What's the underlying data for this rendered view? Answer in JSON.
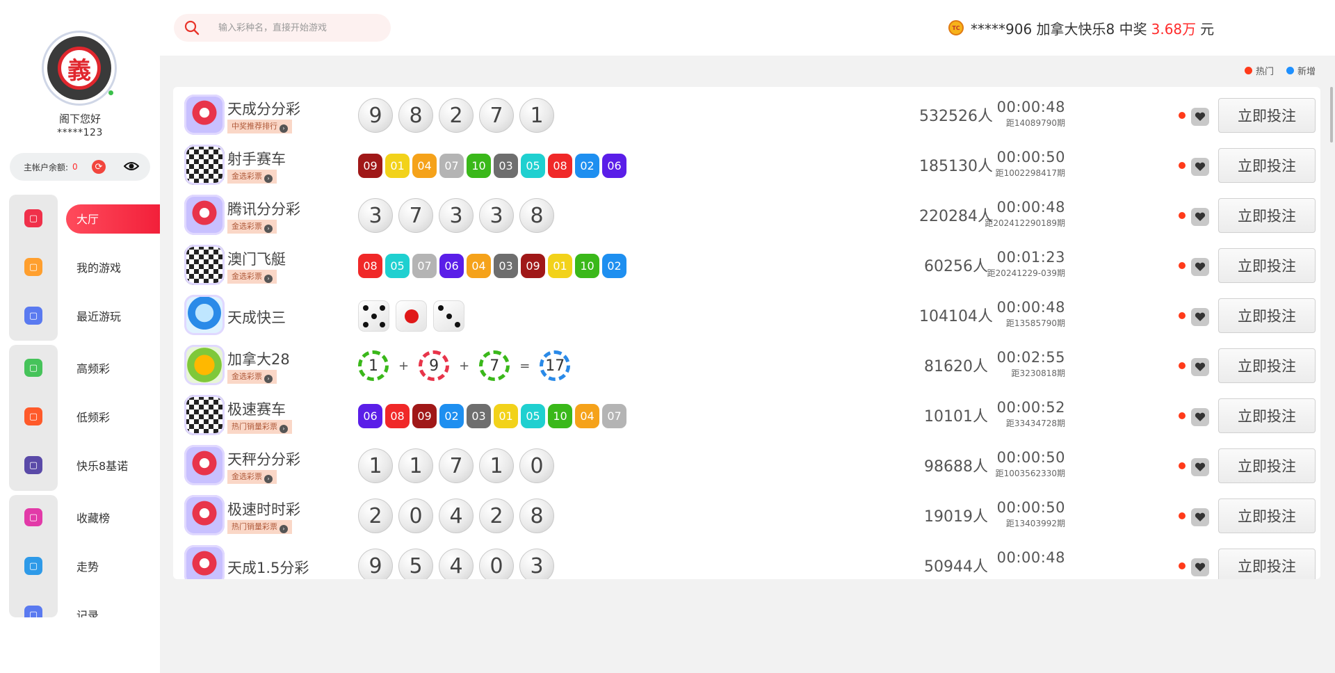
{
  "user": {
    "greeting": "阁下您好",
    "name": "*****123",
    "balance_label": "主帐户余额:",
    "balance_value": "0"
  },
  "nav": [
    {
      "label": "大厅",
      "icon": "home-icon",
      "color": "#f0304a",
      "active": true
    },
    {
      "label": "我的游戏",
      "icon": "grid-icon",
      "color": "#ff9f2e"
    },
    {
      "label": "最近游玩",
      "icon": "recent-icon",
      "color": "#5a7af0"
    },
    {
      "label": "高频彩",
      "icon": "high-freq-icon",
      "color": "#46c35a"
    },
    {
      "label": "低频彩",
      "icon": "low-freq-icon",
      "color": "#ff5a2a"
    },
    {
      "label": "快乐8基诺",
      "icon": "keno-icon",
      "color": "#5a4aa8"
    },
    {
      "label": "收藏榜",
      "icon": "favorites-icon",
      "color": "#e23aa8"
    },
    {
      "label": "走势",
      "icon": "trend-icon",
      "color": "#2e9ae8"
    },
    {
      "label": "记录",
      "icon": "record-icon",
      "color": "#5a7af0"
    }
  ],
  "search": {
    "placeholder": "输入彩种名，直接开始游戏"
  },
  "ticker": {
    "text": "*****906 加拿大快乐8 中奖",
    "amount": "3.68万",
    "unit": "元",
    "badge": "TC"
  },
  "legend": {
    "hot": "热门",
    "new": "新增",
    "hot_color": "#ff3a1a",
    "new_color": "#1e90ff"
  },
  "bet_label": "立即投注",
  "games": [
    {
      "name": "天成分分彩",
      "tag": "中奖推荐排行",
      "type": "big",
      "balls": [
        "9",
        "8",
        "2",
        "7",
        "1"
      ],
      "timer": "00:00:48",
      "period": "距14089790期",
      "people": "532526人",
      "icon": "ssc-icon"
    },
    {
      "name": "射手赛车",
      "tag": "金选彩票",
      "type": "square",
      "balls": [
        "09",
        "01",
        "04",
        "07",
        "10",
        "03",
        "05",
        "08",
        "02",
        "06"
      ],
      "timer": "00:00:50",
      "period": "距1002298417期",
      "people": "185130人",
      "icon": "racing-icon"
    },
    {
      "name": "腾讯分分彩",
      "tag": "金选彩票",
      "type": "big",
      "balls": [
        "3",
        "7",
        "3",
        "3",
        "8"
      ],
      "timer": "00:00:48",
      "period": "距202412290189期",
      "people": "220284人",
      "icon": "ssc-icon"
    },
    {
      "name": "澳门飞艇",
      "tag": "金选彩票",
      "type": "square",
      "balls": [
        "08",
        "05",
        "07",
        "06",
        "04",
        "03",
        "09",
        "01",
        "10",
        "02"
      ],
      "timer": "00:01:23",
      "period": "距20241229-039期",
      "people": "60256人",
      "icon": "racing-icon"
    },
    {
      "name": "天成快三",
      "tag": "",
      "type": "dice",
      "balls": [
        "5",
        "1",
        "3"
      ],
      "timer": "00:00:48",
      "period": "距13585790期",
      "people": "104104人",
      "icon": "k3-icon"
    },
    {
      "name": "加拿大28",
      "tag": "金选彩票",
      "type": "pc28",
      "balls": [
        "1",
        "9",
        "7",
        "17"
      ],
      "ops": [
        "+",
        "+",
        "="
      ],
      "timer": "00:02:55",
      "period": "距3230818期",
      "people": "81620人",
      "icon": "pc28-icon"
    },
    {
      "name": "极速赛车",
      "tag": "热门销量彩票",
      "type": "square",
      "balls": [
        "06",
        "08",
        "09",
        "02",
        "03",
        "01",
        "05",
        "10",
        "04",
        "07"
      ],
      "timer": "00:00:52",
      "period": "距33434728期",
      "people": "10101人",
      "icon": "racing-icon"
    },
    {
      "name": "天秤分分彩",
      "tag": "金选彩票",
      "type": "big",
      "balls": [
        "1",
        "1",
        "7",
        "1",
        "0"
      ],
      "timer": "00:00:50",
      "period": "距1003562330期",
      "people": "98688人",
      "icon": "ssc-icon"
    },
    {
      "name": "极速时时彩",
      "tag": "热门销量彩票",
      "type": "big",
      "balls": [
        "2",
        "0",
        "4",
        "2",
        "8"
      ],
      "timer": "00:00:50",
      "period": "距13403992期",
      "people": "19019人",
      "icon": "ssc-icon"
    },
    {
      "name": "天成1.5分彩",
      "tag": "",
      "type": "big",
      "balls": [
        "9",
        "5",
        "4",
        "0",
        "3"
      ],
      "timer": "00:00:48",
      "period": "",
      "people": "50944人",
      "icon": "ssc-icon"
    }
  ],
  "ball_colors": {
    "01": "#f2d21a",
    "02": "#1e8ff0",
    "03": "#6e6e6e",
    "04": "#f5a21a",
    "05": "#1fd0d0",
    "06": "#5a1ee8",
    "07": "#b4b4b4",
    "08": "#f02828",
    "09": "#a01818",
    "10": "#3ab81a"
  }
}
